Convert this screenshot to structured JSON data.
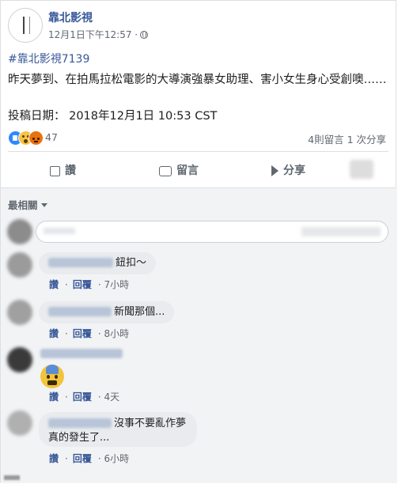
{
  "post": {
    "page_name": "靠北影視",
    "time": "12月1日下午12:57 ·",
    "hashtag": "#靠北影視7139",
    "text": "昨天夢到、在拍馬拉松電影的大導演強暴女助理、害小女生身心受創噢……",
    "date_line": "投稿日期： 2018年12月1日 10:53 CST"
  },
  "reactions": {
    "count": "47",
    "stats": "4則留言  1 次分享"
  },
  "actions": {
    "like": "讚",
    "comment": "留言",
    "share": "分享"
  },
  "comments_header": {
    "sort": "最相關"
  },
  "comments": [
    {
      "text": "鈕扣～",
      "like": "讚",
      "reply": "回覆",
      "time": "7小時"
    },
    {
      "text": "新聞那個...",
      "like": "讚",
      "reply": "回覆",
      "time": "8小時"
    },
    {
      "text": "",
      "like": "讚",
      "reply": "回覆",
      "time": "4天"
    },
    {
      "text_line1": "沒事不要亂作夢",
      "text_line2": "真的發生了...",
      "like": "讚",
      "reply": "回覆",
      "time": "6小時"
    }
  ],
  "colors": {
    "link": "#385898",
    "meta": "#616770",
    "comment_bubble": "#e9ebee",
    "comments_bg": "#f2f3f5"
  }
}
